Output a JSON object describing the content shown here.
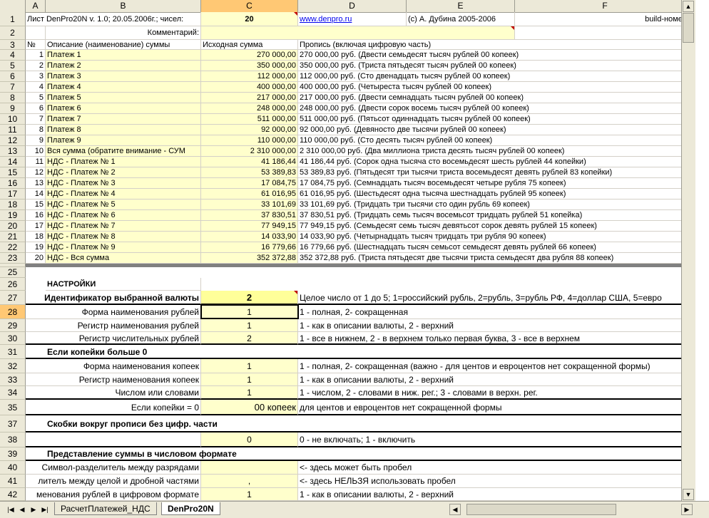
{
  "columns": [
    "A",
    "B",
    "C",
    "D",
    "E",
    "F"
  ],
  "selected_column": "C",
  "selected_row": "28",
  "row1": {
    "num": "1",
    "a": "Лист DenPro20N v. 1.0; 20.05.2006г.; чисел:",
    "c": "20",
    "d": "www.denpro.ru",
    "e": "(с) А. Дубина 2005-2006",
    "f": "build-номер п"
  },
  "row2": {
    "num": "2",
    "b": "Комментарий:"
  },
  "row3": {
    "num": "3",
    "a": "№",
    "b": "Описание (наименование) суммы",
    "c": "Исходная сумма",
    "d": "Пропись (включая цифровую часть)"
  },
  "rows": [
    {
      "num": "4",
      "a": "1",
      "b": "Платеж 1",
      "c": "270 000,00",
      "d": "270 000,00 руб. (Двести семьдесят тысяч рублей 00 копеек)"
    },
    {
      "num": "5",
      "a": "2",
      "b": "Платеж 2",
      "c": "350 000,00",
      "d": "350 000,00 руб. (Триста пятьдесят тысяч рублей 00 копеек)"
    },
    {
      "num": "6",
      "a": "3",
      "b": "Платеж 3",
      "c": "112 000,00",
      "d": "112 000,00 руб. (Сто двенадцать тысяч рублей 00 копеек)"
    },
    {
      "num": "7",
      "a": "4",
      "b": "Платеж 4",
      "c": "400 000,00",
      "d": "400 000,00 руб. (Четыреста тысяч рублей 00 копеек)"
    },
    {
      "num": "8",
      "a": "5",
      "b": "Платеж 5",
      "c": "217 000,00",
      "d": "217 000,00 руб. (Двести семнадцать тысяч рублей 00 копеек)"
    },
    {
      "num": "9",
      "a": "6",
      "b": "Платеж 6",
      "c": "248 000,00",
      "d": "248 000,00 руб. (Двести сорок восемь тысяч рублей 00 копеек)"
    },
    {
      "num": "10",
      "a": "7",
      "b": "Платеж 7",
      "c": "511 000,00",
      "d": "511 000,00 руб. (Пятьсот одиннадцать тысяч рублей 00 копеек)"
    },
    {
      "num": "11",
      "a": "8",
      "b": "Платеж 8",
      "c": "92 000,00",
      "d": "92 000,00 руб. (Девяносто две тысячи рублей 00 копеек)"
    },
    {
      "num": "12",
      "a": "9",
      "b": "Платеж 9",
      "c": "110 000,00",
      "d": "110 000,00 руб. (Сто десять тысяч рублей 00 копеек)"
    },
    {
      "num": "13",
      "a": "10",
      "b": "Вся сумма (обратите внимание - СУМ",
      "c": "2 310 000,00",
      "d": "2 310 000,00 руб. (Два миллиона триста десять тысяч рублей 00 копеек)"
    },
    {
      "num": "14",
      "a": "11",
      "b": "НДС - Платеж № 1",
      "c": "41 186,44",
      "d": "41 186,44 руб. (Сорок одна тысяча сто восемьдесят шесть рублей 44 копейки)"
    },
    {
      "num": "15",
      "a": "12",
      "b": "НДС - Платеж № 2",
      "c": "53 389,83",
      "d": "53 389,83 руб. (Пятьдесят три тысячи триста восемьдесят девять рублей 83 копейки)"
    },
    {
      "num": "16",
      "a": "13",
      "b": "НДС - Платеж № 3",
      "c": "17 084,75",
      "d": "17 084,75 руб. (Семнадцать тысяч восемьдесят четыре рубля 75 копеек)"
    },
    {
      "num": "17",
      "a": "14",
      "b": "НДС - Платеж № 4",
      "c": "61 016,95",
      "d": "61 016,95 руб. (Шестьдесят одна тысяча шестнадцать рублей 95 копеек)"
    },
    {
      "num": "18",
      "a": "15",
      "b": "НДС - Платеж № 5",
      "c": "33 101,69",
      "d": "33 101,69 руб. (Тридцать три тысячи сто один рубль 69 копеек)"
    },
    {
      "num": "19",
      "a": "16",
      "b": "НДС - Платеж № 6",
      "c": "37 830,51",
      "d": "37 830,51 руб. (Тридцать семь тысяч восемьсот тридцать рублей 51 копейка)"
    },
    {
      "num": "20",
      "a": "17",
      "b": "НДС - Платеж № 7",
      "c": "77 949,15",
      "d": "77 949,15 руб. (Семьдесят семь тысяч девятьсот сорок девять рублей 15 копеек)"
    },
    {
      "num": "21",
      "a": "18",
      "b": "НДС - Платеж № 8",
      "c": "14 033,90",
      "d": "14 033,90 руб. (Четырнадцать тысяч тридцать три рубля 90 копеек)"
    },
    {
      "num": "22",
      "a": "19",
      "b": "НДС - Платеж № 9",
      "c": "16 779,66",
      "d": "16 779,66 руб. (Шестнадцать тысяч семьсот семьдесят девять рублей 66 копеек)"
    },
    {
      "num": "23",
      "a": "20",
      "b": "НДС - Вся сумма",
      "c": "352 372,88",
      "d": "352 372,88 руб. (Триста пятьдесят две тысячи триста семьдесят два рубля 88 копеек)"
    }
  ],
  "settings": {
    "r25": "25",
    "r26": {
      "num": "26",
      "b": "НАСТРОЙКИ"
    },
    "r27": {
      "num": "27",
      "b": "Идентификатор выбранной валюты",
      "c": "2",
      "d": "Целое число от 1 до 5; 1=российский рубль, 2=рубль, 3=рубль РФ, 4=доллар США, 5=евро"
    },
    "r28": {
      "num": "28",
      "b": "Форма наименования рублей",
      "c": "1",
      "d": "1 - полная, 2- сокращенная"
    },
    "r29": {
      "num": "29",
      "b": "Регистр наименования рублей",
      "c": "1",
      "d": "1 - как в описании валюты, 2 - верхний"
    },
    "r30": {
      "num": "30",
      "b": "Регистр числительных рублей",
      "c": "2",
      "d": "1 - все в нижнем, 2 - в верхнем только первая буква, 3 - все в верхнем"
    },
    "r31": {
      "num": "31",
      "b": "Если копейки больше 0"
    },
    "r32": {
      "num": "32",
      "b": "Форма наименования копеек",
      "c": "1",
      "d": "1 - полная, 2- сокращенная (важно - для центов и евроцентов нет сокращенной формы)"
    },
    "r33": {
      "num": "33",
      "b": "Регистр наименования копеек",
      "c": "1",
      "d": "1 - как в описании валюты, 2 - верхний"
    },
    "r34": {
      "num": "34",
      "b": "Числом или словами",
      "c": "1",
      "d": "1 - числом, 2 - словами в ниж. рег.; 3 - словами в верхн. рег."
    },
    "r35": {
      "num": "35",
      "b": "Если копейки = 0",
      "c": "00 копеек",
      "d": "для центов и евроцентов нет сокращенной формы"
    },
    "r37": {
      "num": "37",
      "b": "Скобки вокруг прописи без цифр. части"
    },
    "r38": {
      "num": "38",
      "c": "0",
      "d": "0 - не включать; 1 - включить"
    },
    "r39": {
      "num": "39",
      "b": "Представление суммы в числовом формате"
    },
    "r40": {
      "num": "40",
      "b": "Символ-разделитель между разрядами",
      "d": "<- здесь может быть пробел"
    },
    "r41": {
      "num": "41",
      "b": "лителъ между целой и дробной частями",
      "c": ",",
      "d": "<- здесь НЕЛЬЗЯ использовать пробел"
    },
    "r42": {
      "num": "42",
      "b": "менования рублей в цифровом формате",
      "c": "1",
      "d": "1 - как в описании валюты, 2 - верхний"
    }
  },
  "tabs": {
    "tab1": "РасчетПлатежей_НДС",
    "tab2": "DenPro20N"
  },
  "colors": {
    "selected_header": "#ffc874",
    "input_fill": "#ffffcc",
    "header_bg": "#ece9d8"
  }
}
